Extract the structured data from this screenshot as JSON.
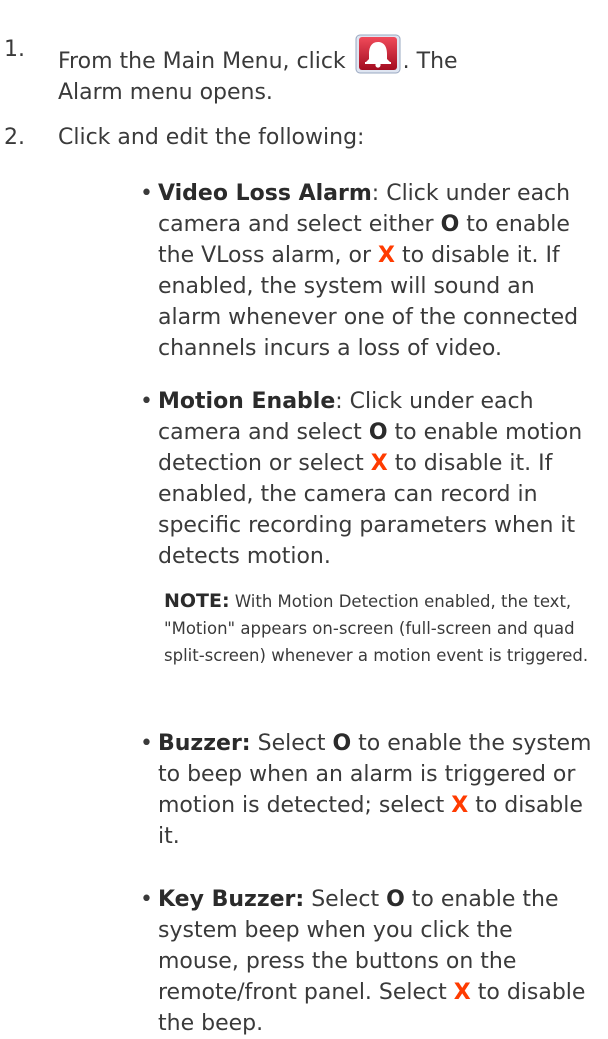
{
  "steps": [
    {
      "num": "1.",
      "pre": "From the Main Menu, click",
      "icon": "alarm-bell-icon",
      "post": ". The",
      "line2": "Alarm menu opens."
    },
    {
      "num": "2.",
      "text": "Click and edit the following:"
    }
  ],
  "bullets": {
    "video_loss": {
      "term": "Video Loss Alarm",
      "t1": ": Click under each camera and select either ",
      "o": "O",
      "t2": " to enable the VLoss alarm, or ",
      "x": "X",
      "t3": " to disable it. If enabled, the system will sound an alarm whenever one of the connected channels incurs a loss of video."
    },
    "motion": {
      "term": "Motion Enable",
      "t1": ": Click under each camera and select ",
      "o": "O",
      "t2": " to enable motion detection or select ",
      "x": "X",
      "t3": " to disable it. If enabled, the camera can record in specific recording parameters when it detects motion."
    },
    "buzzer": {
      "term": "Buzzer:",
      "t1": " Select ",
      "o": "O",
      "t2": " to enable the system to beep when an alarm is triggered or motion is detected; select ",
      "x": "X",
      "t3": " to disable it."
    },
    "key_buzzer": {
      "term": "Key Buzzer:",
      "t1": " Select ",
      "o": "O",
      "t2": " to enable the system beep when you click the mouse, press the buttons on the remote/front panel. Select ",
      "x": "X",
      "t3": " to disable the beep."
    }
  },
  "note": {
    "label": "NOTE:",
    "text": " With Motion Detection enabled, the text, \"Motion\" appears on-screen (full-screen and quad split-screen) whenever a motion event is triggered."
  },
  "colors": {
    "text": "#3a3a3a",
    "x_accent": "#ff3b00",
    "icon_bg": "#c8102e"
  }
}
